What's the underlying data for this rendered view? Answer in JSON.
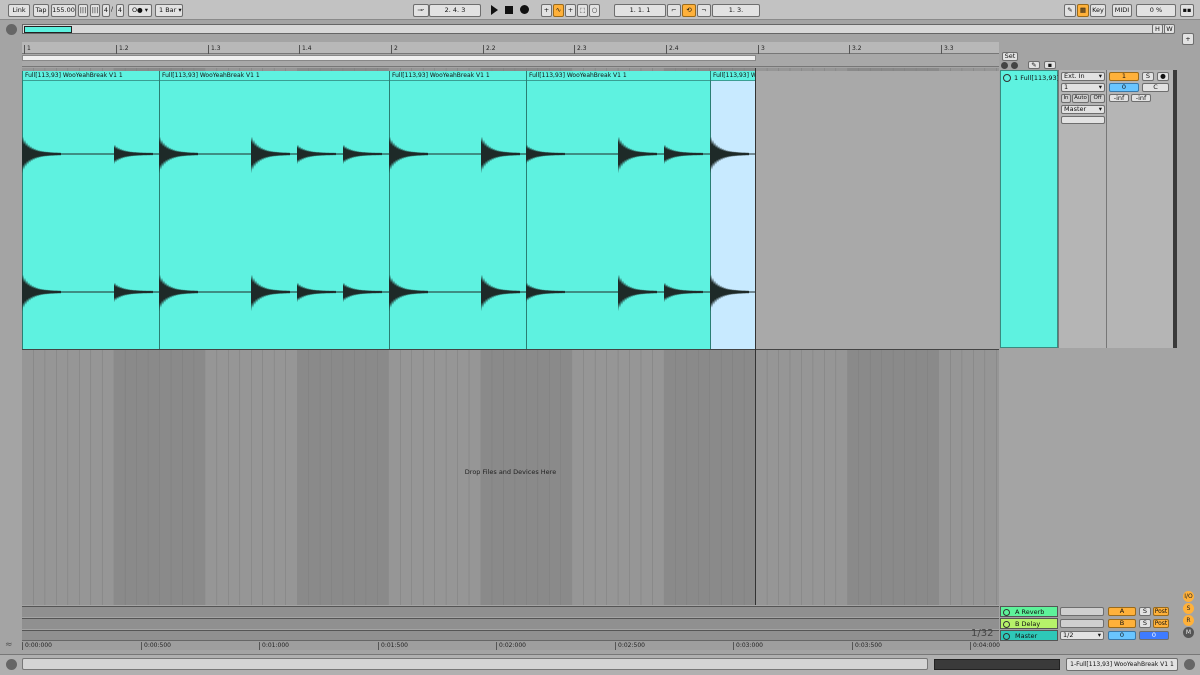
{
  "toolbar": {
    "link_label": "Link",
    "tap_label": "Tap",
    "tempo": "155.00",
    "time_sig_num": "4",
    "time_sig_den": "4",
    "quantize": "1 Bar",
    "position": "2.   4.   3",
    "punch_in": "1.    1.    1",
    "loop_length": "1.    3.",
    "key_label": "Key",
    "midi_label": "MIDI",
    "cpu": "0 %"
  },
  "overview": {
    "io_h": "H",
    "io_w": "W"
  },
  "ruler": {
    "bars": [
      "1",
      "1.2",
      "1.3",
      "1.4",
      "2",
      "2.2",
      "2.3",
      "2.4",
      "3",
      "3.2",
      "3.3"
    ]
  },
  "clips": [
    {
      "name": "Full[113,93] WooYeahBreak V1 1"
    },
    {
      "name": "Full[113,93] WooYeahBreak V1 1"
    },
    {
      "name": "Full[113,93] WooYeahBreak V1 1"
    },
    {
      "name": "Full[113,93] WooYeahBreak V1 1"
    },
    {
      "name": "Full[113,93] W"
    }
  ],
  "arrangement": {
    "drop_hint": "Drop Files and Devices Here"
  },
  "set_label": "Set",
  "track": {
    "name": "1 Full[113,93]",
    "input_type": "Ext. In",
    "input_channel": "1",
    "monitor_in": "In",
    "monitor_auto": "Auto",
    "monitor_off": "Off",
    "output": "Master",
    "track_number": "1",
    "solo": "S",
    "volume": "0",
    "pan": "C",
    "peak_left": "-inf",
    "peak_right": "-inf"
  },
  "return_tracks": [
    {
      "name": "A Reverb",
      "letter": "A",
      "solo": "S",
      "post": "Post",
      "color": "#5ef29a"
    },
    {
      "name": "B Delay",
      "letter": "B",
      "solo": "S",
      "post": "Post",
      "color": "#b6f26a"
    }
  ],
  "master": {
    "name": "Master",
    "quantize": "1/2",
    "volume": "0",
    "pan": "0",
    "color": "#2ec8b8"
  },
  "grid_label": "1/32",
  "time_ruler": [
    "0:00:000",
    "0:00:500",
    "0:01:000",
    "0:01:500",
    "0:02:000",
    "0:02:500",
    "0:03:000",
    "0:03:500",
    "0:04:000"
  ],
  "status": {
    "selected_clip": "1-Full[113,93] WooYeahBreak V1 1"
  },
  "colors": {
    "clip": "#5ef2e0",
    "accent_orange": "#ffb13a",
    "accent_blue": "#69c5ff"
  }
}
